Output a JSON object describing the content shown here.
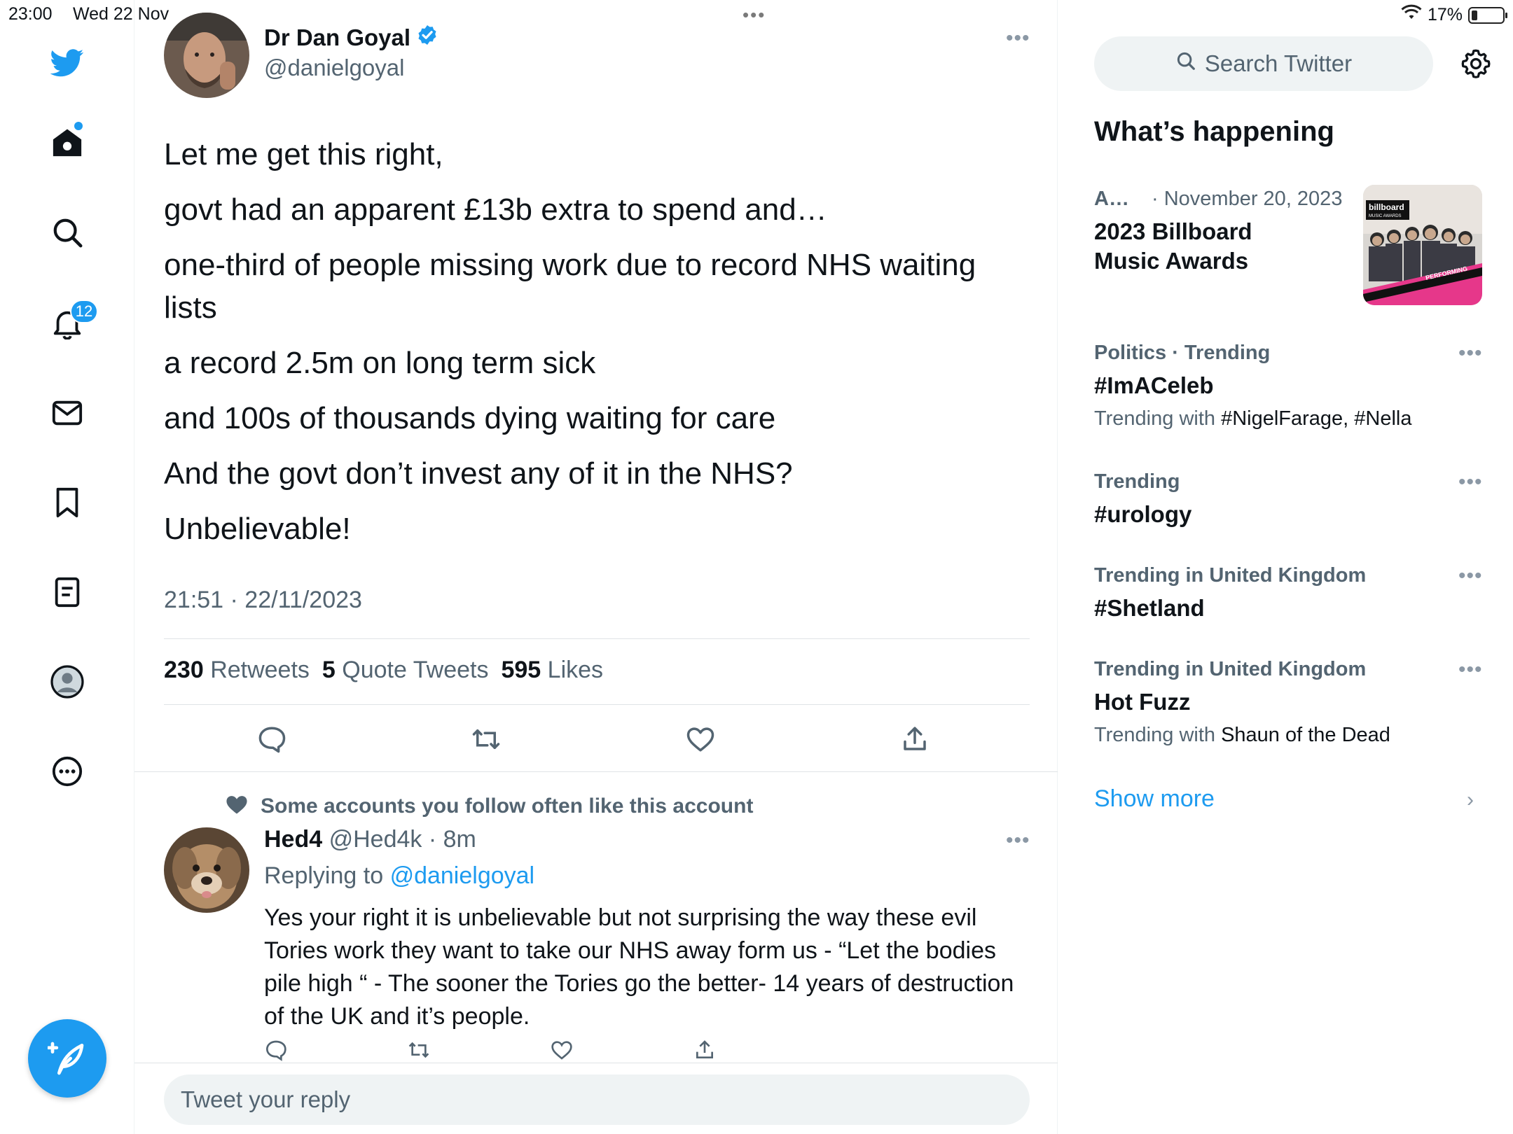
{
  "status_bar": {
    "time": "23:00",
    "date": "Wed 22 Nov",
    "battery": "17%",
    "battery_level": 0.17,
    "multitask_dots": "•••"
  },
  "nav": {
    "notifications_badge": "12"
  },
  "tweet": {
    "author_name": "Dr Dan Goyal",
    "author_handle": "@danielgoyal",
    "lines": [
      "Let me get this right,",
      "govt had an apparent £13b extra to spend and…",
      "one-third of people missing work due to record NHS waiting",
      "lists",
      "a record 2.5m on long term sick",
      "and 100s of thousands dying waiting for care",
      "And the govt don’t invest any of it in the NHS?",
      "Unbelievable!"
    ],
    "timestamp": "21:51 · 22/11/2023",
    "retweets_count": "230",
    "retweets_label": "Retweets",
    "quotes_count": "5",
    "quotes_label": "Quote Tweets",
    "likes_count": "595",
    "likes_label": "Likes"
  },
  "reply": {
    "social_context": "Some accounts you follow often like this account",
    "name": "Hed4",
    "meta": "@Hed4k · 8m",
    "replying_prefix": "Replying to",
    "replying_handle": "@danielgoyal",
    "text": "Yes your right it is unbelievable but not surprising the way these evil Tories work they want to take our NHS away form us - “Let the bodies pile high “ - The sooner the Tories go the better- 14 years of destruction of the UK and it’s people."
  },
  "reply_input": {
    "placeholder": "Tweet your reply"
  },
  "sidebar": {
    "search_placeholder": "Search Twitter",
    "section_title": "What’s happening",
    "trends": [
      {
        "meta_left": "A…",
        "meta_right": "· November 20, 2023",
        "title_line1": "2023 Billboard",
        "title_line2": "Music Awards",
        "thumb_text_top": "billboard",
        "thumb_text_sub": "MUSIC AWARDS",
        "thumb_text_banner": "PERFORMING"
      },
      {
        "meta": "Politics · Trending",
        "title": "#ImACeleb",
        "with_prefix": "Trending with",
        "with_value": "#NigelFarage, #Nella"
      },
      {
        "meta": "Trending",
        "title": "#urology"
      },
      {
        "meta": "Trending in United Kingdom",
        "title": "#Shetland"
      },
      {
        "meta": "Trending in United Kingdom",
        "title": "Hot Fuzz",
        "with_prefix": "Trending with",
        "with_value": "Shaun of the Dead"
      }
    ],
    "show_more": "Show more"
  },
  "colors": {
    "accent": "#1d9bf0",
    "text_primary": "#0f1419",
    "text_secondary": "#536471",
    "divider": "#dfe3e6"
  }
}
